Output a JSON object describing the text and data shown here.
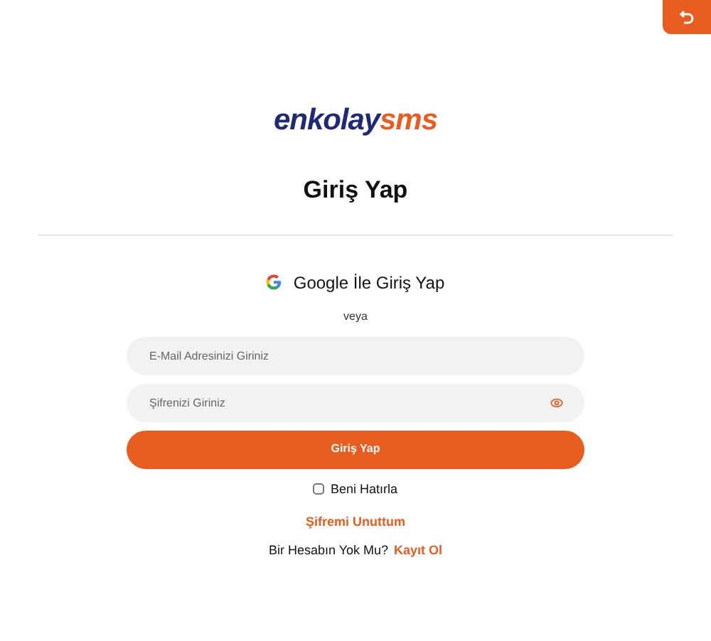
{
  "logo": {
    "part_1": "enkolay",
    "part_2": "sms"
  },
  "title": "Giriş Yap",
  "google_button": {
    "label": "Google İle Giriş Yap"
  },
  "separator": "veya",
  "email": {
    "placeholder": "E-Mail Adresinizi Giriniz"
  },
  "password": {
    "placeholder": "Şifrenizi Giriniz"
  },
  "submit": "Giriş Yap",
  "remember": {
    "label": "Beni Hatırla",
    "checked": false
  },
  "forgot": "Şifremi Unuttum",
  "register": {
    "text": "Bir Hesabın Yok Mu?",
    "link": "Kayıt Ol"
  }
}
